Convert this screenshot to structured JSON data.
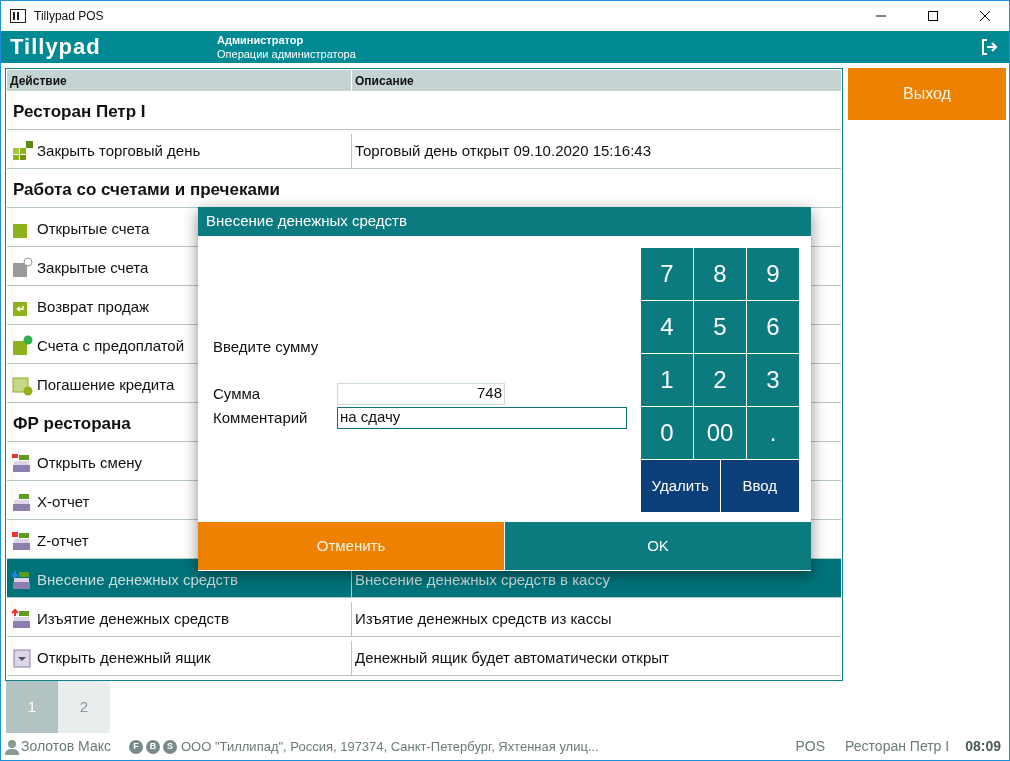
{
  "window": {
    "title": "Tillypad POS"
  },
  "header": {
    "logo": "Tillypad",
    "user_role": "Администратор",
    "screen": "Операции администратора"
  },
  "table": {
    "columns": [
      "Действие",
      "Описание"
    ],
    "rows": [
      {
        "kind": "group",
        "action": "Ресторан Петр I",
        "selected": false
      },
      {
        "kind": "action",
        "action": "Закрыть торговый день",
        "description": "Торговый день открыт 09.10.2020 15:16:43",
        "selected": false
      },
      {
        "kind": "group",
        "action": "Работа со счетами и пречеками",
        "selected": false
      },
      {
        "kind": "action",
        "action": "Открытые счета",
        "selected": false
      },
      {
        "kind": "action",
        "action": "Закрытые счета",
        "selected": false
      },
      {
        "kind": "action",
        "action": "Возврат продаж",
        "selected": false
      },
      {
        "kind": "action",
        "action": "Счета с предоплатой",
        "selected": false
      },
      {
        "kind": "action",
        "action": "Погашение кредита",
        "selected": false
      },
      {
        "kind": "group",
        "action": "ФР ресторана",
        "selected": false
      },
      {
        "kind": "action",
        "action": "Открыть смену",
        "selected": false
      },
      {
        "kind": "action",
        "action": "X-отчет",
        "selected": false
      },
      {
        "kind": "action",
        "action": "Z-отчет",
        "selected": false
      },
      {
        "kind": "action",
        "action": "Внесение денежных средств",
        "description": "Внесение денежных средств в кассу",
        "selected": true
      },
      {
        "kind": "action",
        "action": "Изъятие денежных средств",
        "description": "Изъятие денежных средств из кассы",
        "selected": false
      },
      {
        "kind": "action",
        "action": "Открыть денежный ящик",
        "description": "Денежный ящик будет автоматически открыт",
        "selected": false
      }
    ]
  },
  "side_buttons": [
    "Выход"
  ],
  "pages": [
    {
      "label": "1",
      "selected": true
    },
    {
      "label": "2",
      "selected": false
    }
  ],
  "status_bar": {
    "user": "Золотов Макс",
    "badges": [
      "F",
      "B",
      "S"
    ],
    "organization": "ООО \"Тиллипад\", Россия, 197374, Санкт-Петербург, Яхтенная улиц...",
    "terminal": "POS",
    "restaurant": "Ресторан Петр I",
    "time": "08:09"
  },
  "dialog": {
    "title": "Внесение денежных средств",
    "prompt": "Введите сумму",
    "fields": [
      {
        "label": "Сумма",
        "value": "748",
        "focused": false
      },
      {
        "label": "Комментарий",
        "value": "на сдачу",
        "focused": true
      }
    ],
    "keypad": [
      {
        "label": "7",
        "kind": "digit"
      },
      {
        "label": "8",
        "kind": "digit"
      },
      {
        "label": "9",
        "kind": "digit"
      },
      {
        "label": "4",
        "kind": "digit"
      },
      {
        "label": "5",
        "kind": "digit"
      },
      {
        "label": "6",
        "kind": "digit"
      },
      {
        "label": "1",
        "kind": "digit"
      },
      {
        "label": "2",
        "kind": "digit"
      },
      {
        "label": "3",
        "kind": "digit"
      },
      {
        "label": "0",
        "kind": "digit"
      },
      {
        "label": "00",
        "kind": "digit"
      },
      {
        "label": ".",
        "kind": "digit"
      }
    ],
    "keypad_actions": [
      {
        "label": "Удалить"
      },
      {
        "label": "Ввод"
      }
    ],
    "cancel": "Отменить",
    "ok": "OK"
  }
}
